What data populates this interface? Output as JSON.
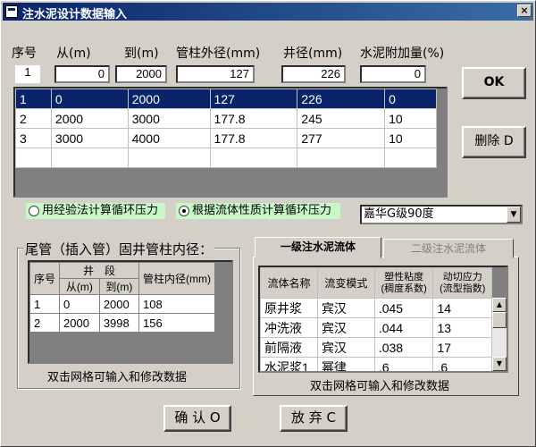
{
  "window": {
    "title": "注水泥设计数据输入",
    "close_glyph": "×"
  },
  "top_labels": {
    "seq": "序号",
    "from": "从(m)",
    "to": "到(m)",
    "casing_od": "管柱外径(mm)",
    "well_dia": "井径(mm)",
    "cement_extra": "水泥附加量(%)"
  },
  "top_inputs": {
    "seq": "1",
    "from": "0",
    "to": "2000",
    "casing_od": "127",
    "well_dia": "226",
    "cement_extra": "0"
  },
  "buttons": {
    "ok": "OK",
    "delete": "删除 D",
    "confirm": "确 认 O",
    "abandon": "放 弃 C"
  },
  "main_grid": {
    "rows": [
      [
        "1",
        "0",
        "2000",
        "127",
        "226",
        "0"
      ],
      [
        "2",
        "2000",
        "3000",
        "177.8",
        "245",
        "10"
      ],
      [
        "3",
        "3000",
        "4000",
        "177.8",
        "277",
        "10"
      ]
    ]
  },
  "radios": {
    "empirical": "用经验法计算循环压力",
    "rheology": "根据流体性质计算循环压力"
  },
  "combo": {
    "value": "嘉华G级90度",
    "arrow": "▼"
  },
  "liner_group": {
    "title": "尾管（插入管）固井管柱内径：",
    "hdr_seq": "序号",
    "hdr_section": "井　段",
    "hdr_from": "从(m)",
    "hdr_to": "到(m)",
    "hdr_inner": "管柱内径(mm)",
    "rows": [
      [
        "1",
        "0",
        "2000",
        "108"
      ],
      [
        "2",
        "2000",
        "3998",
        "156"
      ]
    ],
    "hint": "双击网格可输入和修改数据"
  },
  "fluid_tabs": {
    "tab1": "一级注水泥流体",
    "tab2": "二级注水泥流体",
    "headers": [
      "流体名称",
      "流变模式",
      "塑性粘度(稠度系数)",
      "动切应力(流型指数)"
    ],
    "rows": [
      [
        "原井浆",
        "宾汉",
        ".045",
        "14"
      ],
      [
        "冲洗液",
        "宾汉",
        ".044",
        "13"
      ],
      [
        "前隔液",
        "宾汉",
        ".038",
        "17"
      ],
      [
        "水泥浆1",
        "幂律",
        ".6",
        ".6"
      ]
    ],
    "hint": "双击网格可输入和修改数据"
  },
  "colors": {
    "selection": "#0a246a",
    "radio_bg": "#c8f7c8",
    "title_start": "#0a246a",
    "title_end": "#3a6ea5"
  }
}
